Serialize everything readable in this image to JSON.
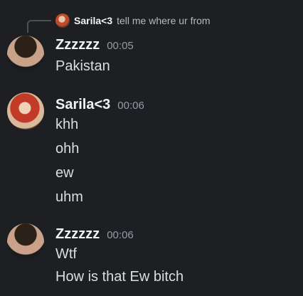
{
  "reply": {
    "username": "Sarila<3",
    "text": "tell me where ur from"
  },
  "messages": [
    {
      "username": "Zzzzzz",
      "time": "00:05",
      "lines": [
        "Pakistan"
      ]
    },
    {
      "username": "Sarila<3",
      "time": "00:06",
      "lines": [
        "khh",
        "ohh",
        "ew",
        "uhm"
      ]
    },
    {
      "username": "Zzzzzz",
      "time": "00:06",
      "lines": [
        "Wtf",
        "How is that Ew bitch"
      ]
    }
  ]
}
